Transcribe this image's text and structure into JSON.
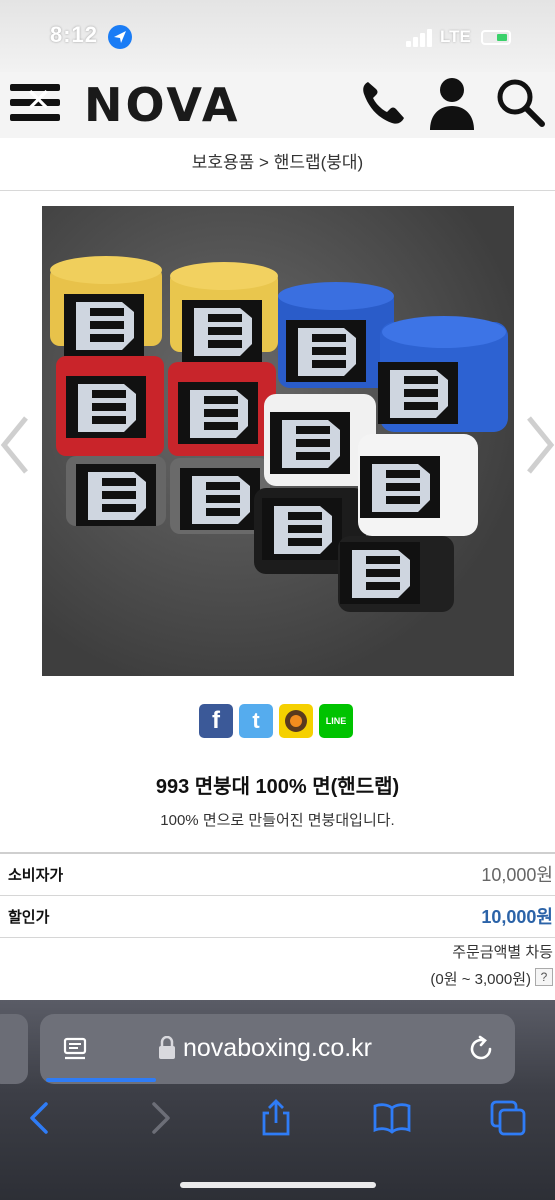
{
  "status_bar": {
    "time": "8:12",
    "network": "LTE"
  },
  "header": {
    "logo": "NOVA"
  },
  "breadcrumb": "보호용품 > 핸드랩(붕대)",
  "share": {
    "facebook": "f",
    "twitter": "t",
    "line": "LINE"
  },
  "product": {
    "title": "993 면붕대 100% 면(핸드랩)",
    "description": "100% 면으로 만들어진 면붕대입니다."
  },
  "prices": {
    "consumer_label": "소비자가",
    "consumer_value": "10,000원",
    "discount_label": "할인가",
    "discount_value": "10,000원"
  },
  "shipping": {
    "note": "주문금액별 차등",
    "range": "(0원 ~ 3,000원)",
    "help": "?"
  },
  "browser": {
    "url": "novaboxing.co.kr",
    "load_progress": 0.25
  },
  "colors": {
    "accent": "#2f7cf6",
    "discount_price": "#2b63a8",
    "facebook": "#3b5998",
    "twitter": "#55acee",
    "line": "#00c300"
  }
}
